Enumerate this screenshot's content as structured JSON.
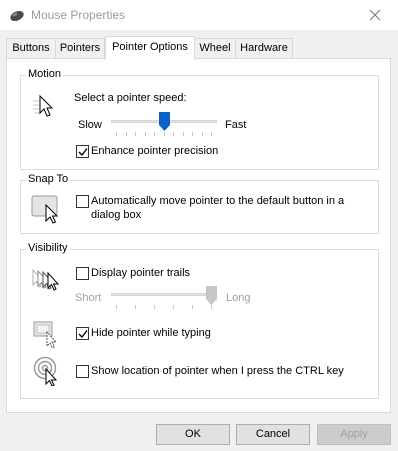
{
  "window": {
    "title": "Mouse Properties",
    "app_icon": "mouse-icon",
    "close_icon": "close-icon"
  },
  "tabs": [
    {
      "label": "Buttons"
    },
    {
      "label": "Pointers"
    },
    {
      "label": "Pointer Options",
      "active": true
    },
    {
      "label": "Wheel"
    },
    {
      "label": "Hardware"
    }
  ],
  "motion": {
    "group_label": "Motion",
    "speed_label": "Select a pointer speed:",
    "slow_label": "Slow",
    "fast_label": "Fast",
    "speed_value": 0.5,
    "precision_label": "Enhance pointer precision",
    "precision_checked": true,
    "icon": "pointer-speed-icon"
  },
  "snap_to": {
    "group_label": "Snap To",
    "label_line1": "Automatically move pointer to the default button in a",
    "label_line2": "dialog box",
    "checked": false,
    "icon": "snap-to-button-icon"
  },
  "visibility": {
    "group_label": "Visibility",
    "trails_label": "Display pointer trails",
    "trails_checked": false,
    "short_label": "Short",
    "long_label": "Long",
    "trails_length": 1.0,
    "hide_label": "Hide pointer while typing",
    "hide_checked": true,
    "ctrl_label": "Show location of pointer when I press the CTRL key",
    "ctrl_checked": false,
    "icons": [
      "pointer-trails-icon",
      "hide-pointer-icon",
      "pointer-location-icon"
    ]
  },
  "buttons": {
    "ok": "OK",
    "cancel": "Cancel",
    "apply": "Apply"
  }
}
